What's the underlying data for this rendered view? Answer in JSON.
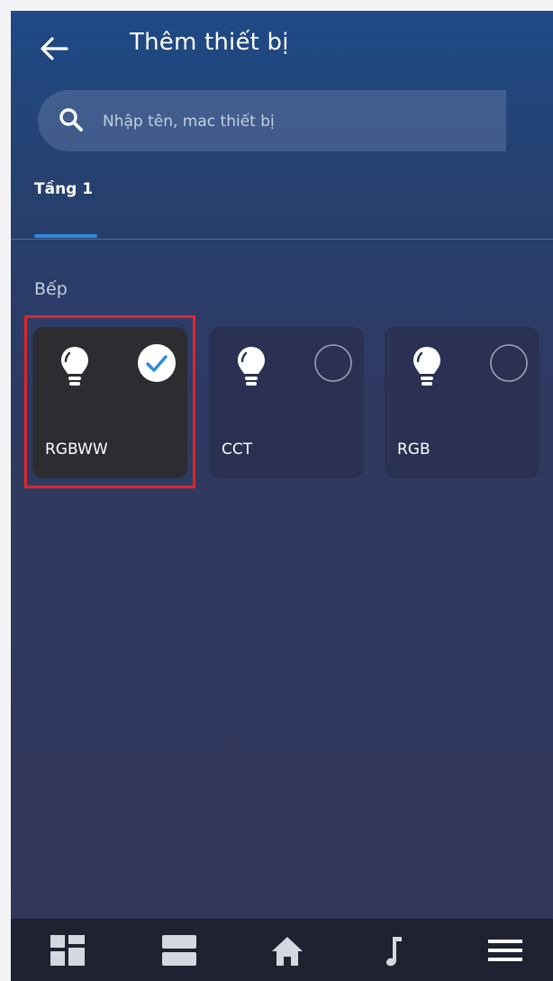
{
  "header": {
    "title": "Thêm thiết bị",
    "back_icon": "arrow-left-icon"
  },
  "search": {
    "placeholder": "Nhập tên, mac thiết bị",
    "value": "",
    "icon": "search-icon"
  },
  "tabs": [
    {
      "label": "Tầng 1",
      "active": true
    }
  ],
  "room": {
    "name": "Bếp"
  },
  "devices": [
    {
      "label": "RGBWW",
      "icon": "lightbulb-icon",
      "selected": true
    },
    {
      "label": "CCT",
      "icon": "lightbulb-icon",
      "selected": false
    },
    {
      "label": "RGB",
      "icon": "lightbulb-icon",
      "selected": false
    }
  ],
  "bottom_nav": [
    {
      "icon": "dashboard-icon"
    },
    {
      "icon": "rooms-icon"
    },
    {
      "icon": "home-icon"
    },
    {
      "icon": "music-icon"
    },
    {
      "icon": "menu-icon"
    }
  ],
  "colors": {
    "accent": "#2d8ae0",
    "highlight": "#e0262a",
    "check": "#2d8ae0"
  }
}
